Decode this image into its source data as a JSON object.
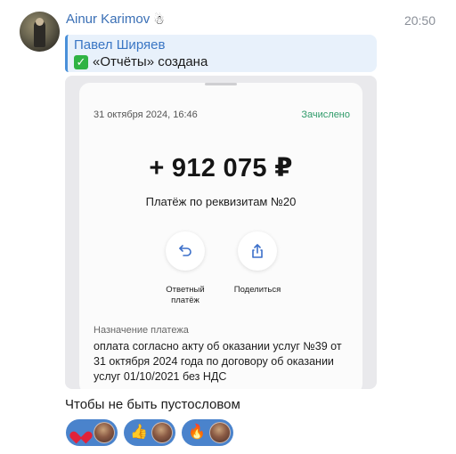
{
  "message": {
    "sender_name": "Ainur Karimov",
    "sender_badge": "☃",
    "time": "20:50",
    "reply": {
      "name": "Павел Ширяев",
      "text": "«Отчёты» создана",
      "check": "✓"
    },
    "caption": "Чтобы не быть пустословом"
  },
  "receipt": {
    "date": "31 октября 2024, 16:46",
    "status": "Зачислено",
    "amount": "+ 912 075 ₽",
    "payment_name": "Платёж по реквизитам №20",
    "actions": [
      {
        "label_line1": "Ответный",
        "label_line2": "платёж",
        "icon": "return-arrow-icon"
      },
      {
        "label_line1": "Поделиться",
        "label_line2": "",
        "icon": "share-icon"
      }
    ],
    "purpose_label": "Назначение платежа",
    "purpose_text": "оплата согласно акту об оказании услуг №39 от 31 октября 2024 года по договору об оказании услуг 01/10/2021 без НДС"
  },
  "reactions": [
    {
      "emoji_name": "heart",
      "emoji": ""
    },
    {
      "emoji_name": "thumbs-up",
      "emoji": "👍"
    },
    {
      "emoji_name": "fire",
      "emoji": "🔥"
    }
  ],
  "colors": {
    "sender": "#3a6fb5",
    "reply_bg": "#e8f1fb",
    "status_green": "#2f9b6a",
    "reaction_bg": "#4a83cc"
  }
}
